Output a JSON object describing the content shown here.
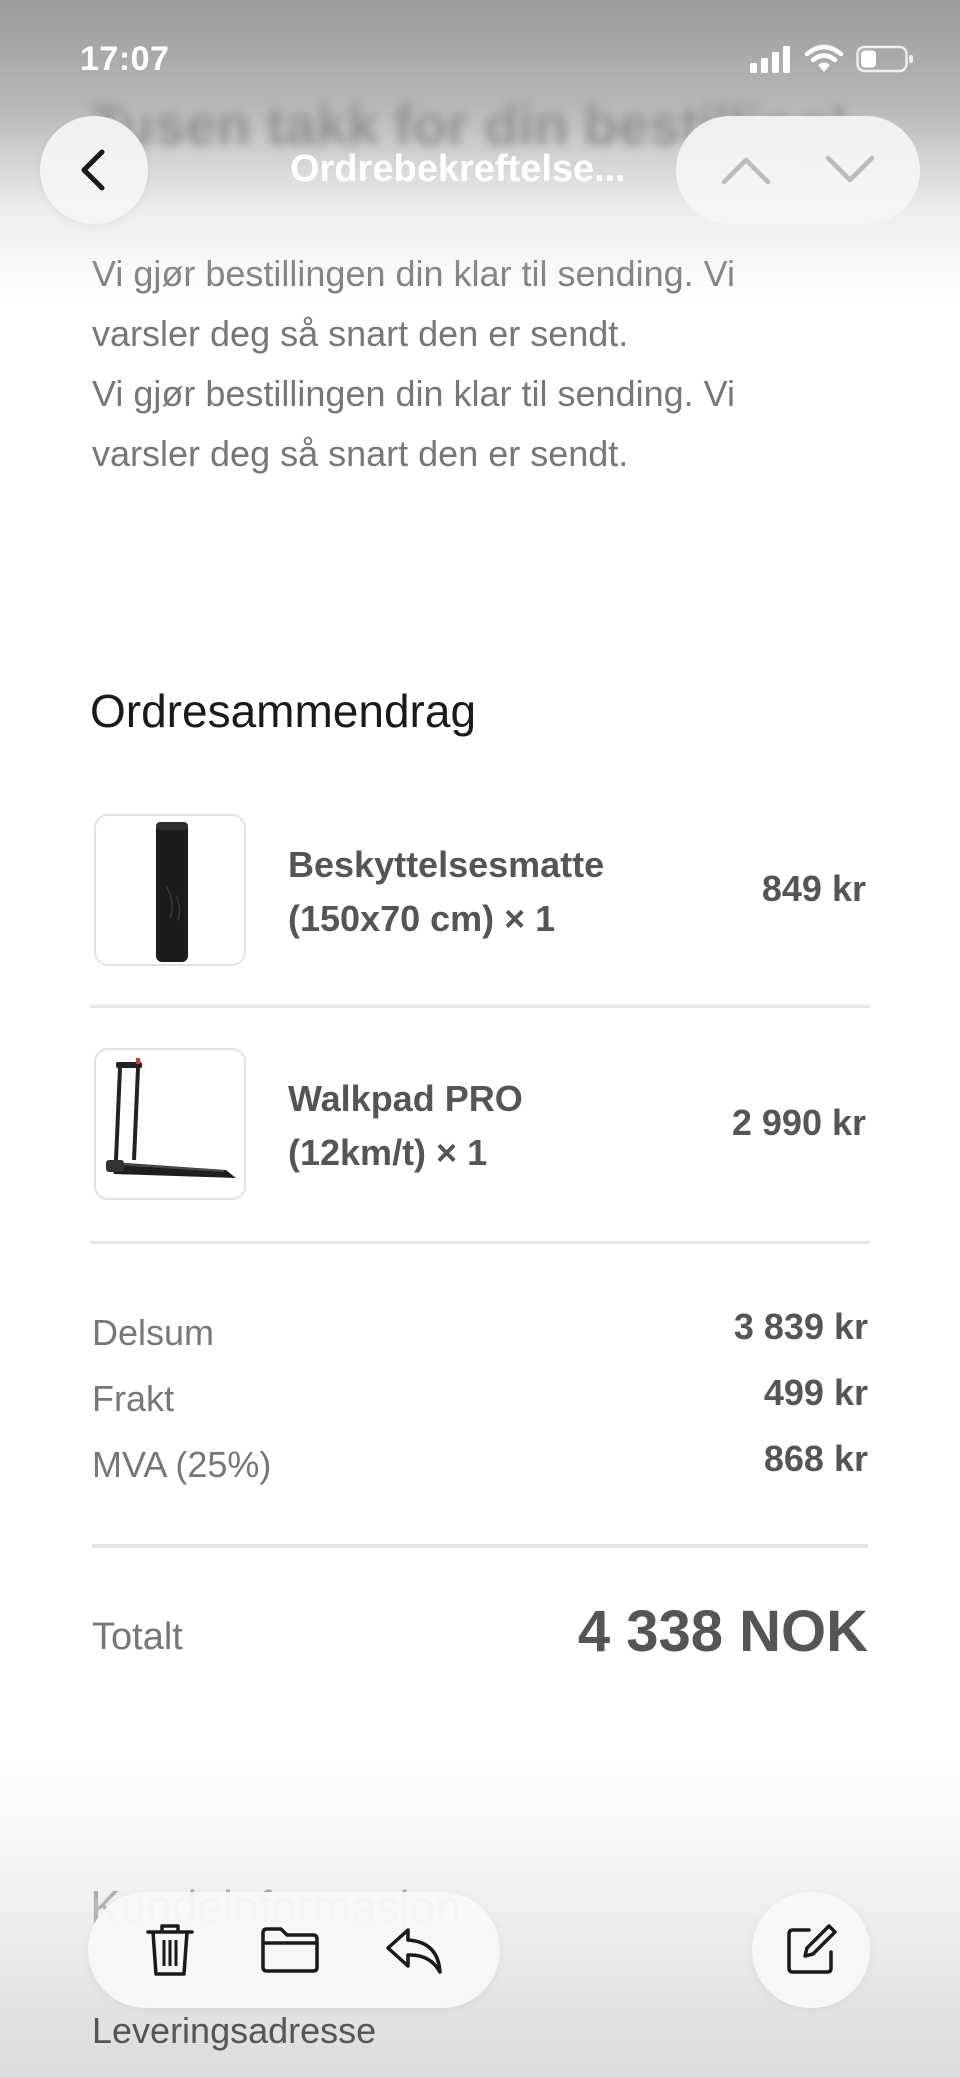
{
  "status_bar": {
    "time": "17:07"
  },
  "nav": {
    "title": "Ordrebekreftelse...",
    "blurred_heading": "Tusen takk for din bestilling!"
  },
  "intro": {
    "lines": [
      "Vi gjør bestillingen din klar til sending. Vi",
      "varsler deg så snart den er sendt.",
      "Vi gjør bestillingen din klar til sending. Vi",
      "varsler deg så snart den er sendt."
    ]
  },
  "summary": {
    "title": "Ordresammendrag",
    "items": [
      {
        "name_line1": "Beskyttelsesmatte",
        "name_line2": "(150x70 cm) × 1",
        "price": "849 kr",
        "image": "rolled-mat-image"
      },
      {
        "name_line1": "Walkpad PRO",
        "name_line2": "(12km/t) × 1",
        "price": "2 990 kr",
        "image": "treadmill-image"
      }
    ],
    "subtotals": [
      {
        "label": "Delsum",
        "value": "3 839 kr"
      },
      {
        "label": "Frakt",
        "value": "499 kr"
      },
      {
        "label": "MVA (25%)",
        "value": "868 kr"
      }
    ],
    "total_label": "Totalt",
    "total_value": "4 338 NOK"
  },
  "customer": {
    "heading": "Kundeinformasjon",
    "delivery_label": "Leveringsadresse"
  },
  "toolbar": {
    "icons": [
      "trash-icon",
      "folder-icon",
      "reply-icon",
      "compose-icon"
    ]
  },
  "colors": {
    "text_muted": "#777777",
    "text_dark": "#1a1a1a",
    "divider": "#e6e6e6"
  }
}
